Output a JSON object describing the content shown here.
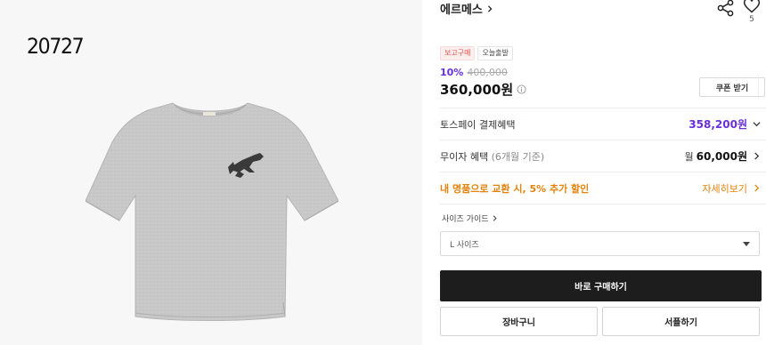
{
  "product": {
    "code_overlay": "20727",
    "brand": "에르메스",
    "like_count": "5",
    "tags": [
      "보고구매",
      "오늘출발"
    ],
    "discount_rate": "10%",
    "original_price": "400,000",
    "price": "360,000원",
    "coupon_label": "쿠폰 받기"
  },
  "benefits": {
    "toss_label": "토스페이 결제혜택",
    "toss_value": "358,200원",
    "installment_label": "무이자 혜택",
    "installment_sub": "(6개월 기준)",
    "installment_prefix": "월",
    "installment_value": "60,000원",
    "trade_label": "내 명품으로 교환 시, 5% 추가 할인",
    "trade_link": "자세히보기"
  },
  "options": {
    "size_guide": "사이즈 가이드",
    "size_selected": "L 사이즈"
  },
  "actions": {
    "buy_now": "바로 구매하기",
    "cart": "장바구니",
    "sample": "서플하기"
  },
  "colors": {
    "accent_purple": "#6b2fd9",
    "accent_orange": "#e3830c",
    "tag_red": "#e4524f",
    "buy_button": "#1d1d1d",
    "shirt_gray": "#c9c9c9"
  },
  "icons": [
    "share-icon",
    "heart-icon",
    "chevron-right-icon",
    "chevron-down-icon",
    "info-icon",
    "caret-down-icon"
  ]
}
